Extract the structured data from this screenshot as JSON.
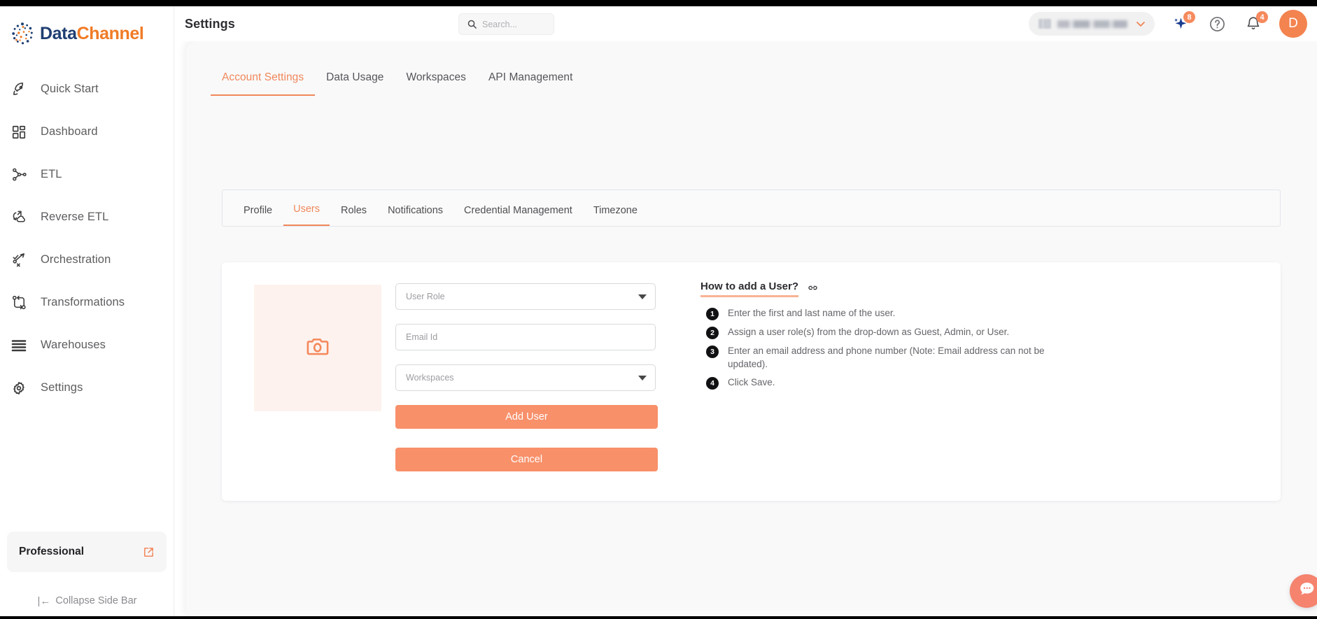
{
  "brand": {
    "name_part1": "Data",
    "name_part2": "Channel",
    "accent": "#f0885a",
    "primary_blue": "#1f3f72",
    "primary_orange": "#f07b26"
  },
  "sidebar": {
    "items": [
      {
        "label": "Quick Start",
        "icon": "rocket-icon"
      },
      {
        "label": "Dashboard",
        "icon": "grid-icon"
      },
      {
        "label": "ETL",
        "icon": "etl-nodes-icon"
      },
      {
        "label": "Reverse ETL",
        "icon": "reverse-etl-icon"
      },
      {
        "label": "Orchestration",
        "icon": "orchestration-icon"
      },
      {
        "label": "Transformations",
        "icon": "transformations-icon"
      },
      {
        "label": "Warehouses",
        "icon": "warehouse-stack-icon"
      },
      {
        "label": "Settings",
        "icon": "gear-icon"
      }
    ],
    "plan": {
      "label": "Professional",
      "icon": "external-link-icon"
    },
    "collapse": {
      "label": "Collapse Side Bar",
      "icon": "collapse-left-icon"
    }
  },
  "header": {
    "title": "Settings",
    "search": {
      "placeholder": "Search...",
      "value": "",
      "icon": "search-icon"
    },
    "org_selector": {
      "value": "",
      "icon": "building-icon",
      "chevron": "chevron-down-icon"
    },
    "ai_assistant": {
      "icon": "sparkle-icon",
      "badge": "8"
    },
    "help": {
      "icon": "question-circle-icon"
    },
    "notifications": {
      "icon": "bell-icon",
      "badge": "4"
    },
    "avatar": {
      "initial": "D",
      "color": "#f3834f"
    }
  },
  "main": {
    "top_tabs": [
      {
        "label": "Account Settings",
        "active": true
      },
      {
        "label": "Data Usage",
        "active": false
      },
      {
        "label": "Workspaces",
        "active": false
      },
      {
        "label": "API Management",
        "active": false
      }
    ],
    "sub_tabs": [
      {
        "label": "Profile",
        "active": false
      },
      {
        "label": "Users",
        "active": true
      },
      {
        "label": "Roles",
        "active": false
      },
      {
        "label": "Notifications",
        "active": false
      },
      {
        "label": "Credential Management",
        "active": false
      },
      {
        "label": "Timezone",
        "active": false
      }
    ],
    "form": {
      "avatar_upload": {
        "icon": "camera-icon",
        "bg": "#fdf2ee"
      },
      "fields": [
        {
          "name": "user-role",
          "placeholder": "User Role",
          "value": "",
          "type": "select"
        },
        {
          "name": "email-id",
          "placeholder": "Email Id",
          "value": "",
          "type": "text"
        },
        {
          "name": "workspaces",
          "placeholder": "Workspaces",
          "value": "",
          "type": "select"
        }
      ],
      "add_user_label": "Add User",
      "cancel_label": "Cancel",
      "button_color": "#f8906a"
    },
    "howto": {
      "title": "How to add a User?",
      "link_icon": "link-icon",
      "steps": [
        {
          "num": "1",
          "text": "Enter the first and last name of the user."
        },
        {
          "num": "2",
          "text": "Assign a user role(s) from the drop-down as Guest, Admin, or User."
        },
        {
          "num": "3",
          "text": "Enter an email address and phone number (Note: Email address can not be updated)."
        },
        {
          "num": "4",
          "text": "Click Save."
        }
      ]
    }
  },
  "chat_widget": {
    "icon": "chat-bubble-icon",
    "color": "#f5836e"
  }
}
